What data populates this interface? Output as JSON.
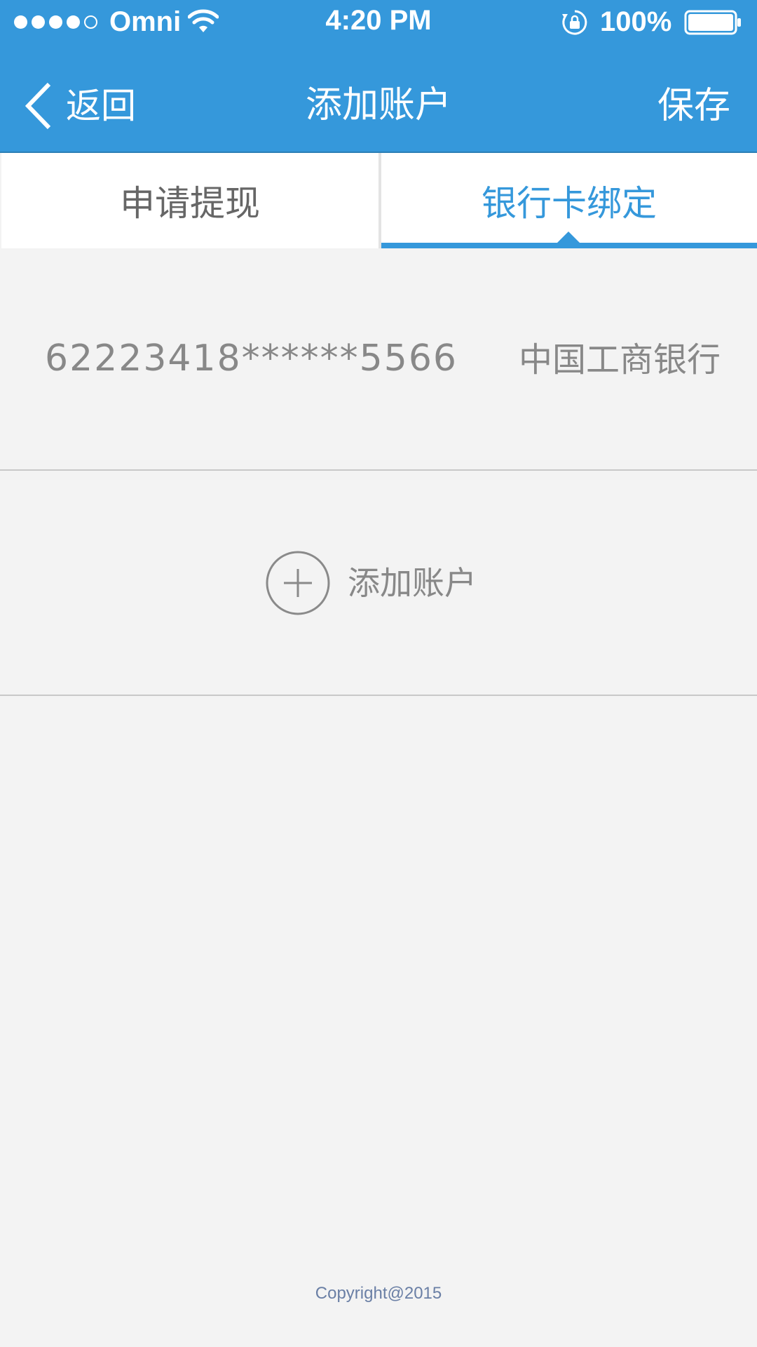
{
  "status_bar": {
    "carrier": "Omni",
    "time": "4:20 PM",
    "battery": "100%",
    "signal_icon": "signal-dots-icon",
    "wifi_icon": "wifi-icon",
    "lock_icon": "orientation-lock-icon",
    "battery_icon": "battery-icon"
  },
  "nav": {
    "back_label": "返回",
    "back_icon": "chevron-left-icon",
    "title": "添加账户",
    "save_label": "保存"
  },
  "tabs": [
    {
      "label": "申请提现",
      "active": false
    },
    {
      "label": "银行卡绑定",
      "active": true
    }
  ],
  "account": {
    "card_number": "62223418******5566",
    "bank_name": "中国工商银行"
  },
  "add_account": {
    "label": "添加账户",
    "icon": "plus-circle-icon"
  },
  "footer": {
    "copyright": "Copyright@2015"
  },
  "colors": {
    "primary": "#3598db",
    "background": "#f3f3f3",
    "text_gray": "#888888"
  }
}
